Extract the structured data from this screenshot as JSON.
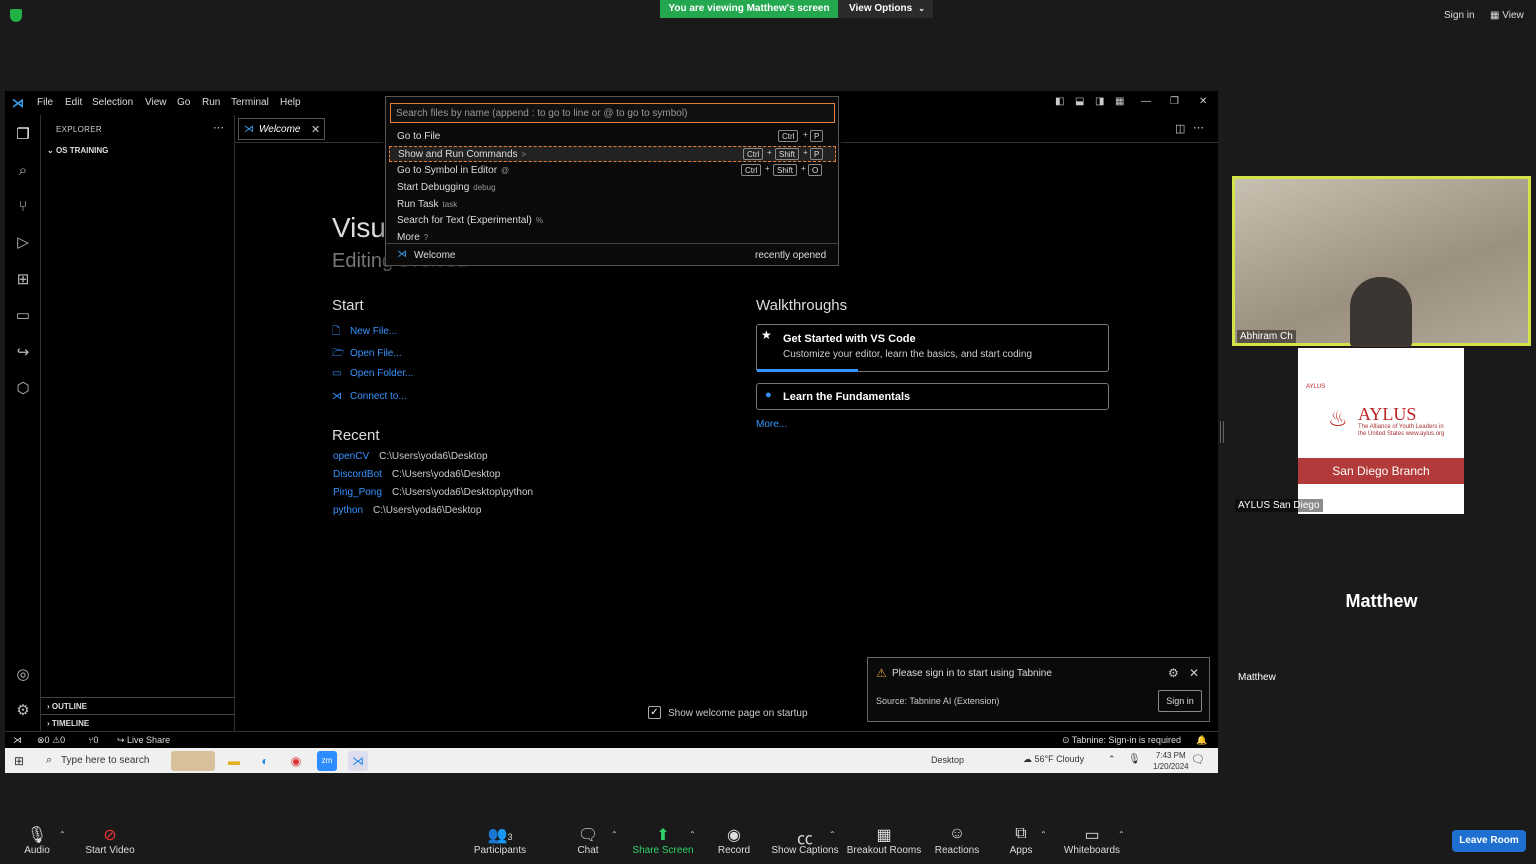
{
  "zoom": {
    "banner": "You are viewing Matthew's screen",
    "view_options": "View Options",
    "sign_in": "Sign in",
    "view": "View",
    "participants": [
      {
        "name": "Abhiram Ch"
      },
      {
        "name": "AYLUS San Diego"
      },
      {
        "name": "Matthew"
      }
    ],
    "aylus_logo": {
      "small": "AYLUS",
      "name": "AYLUS",
      "tagline": "The Alliance of Youth Leaders in the United States www.aylus.org",
      "branch": "San Diego Branch"
    },
    "toolbar": [
      {
        "label": "Audio",
        "icon": "microphone-icon"
      },
      {
        "label": "Start Video",
        "icon": "video-off-icon"
      },
      {
        "label": "Participants",
        "icon": "participants-icon",
        "count": "3"
      },
      {
        "label": "Chat",
        "icon": "chat-icon"
      },
      {
        "label": "Share Screen",
        "icon": "share-screen-icon"
      },
      {
        "label": "Record",
        "icon": "record-icon"
      },
      {
        "label": "Show Captions",
        "icon": "captions-icon"
      },
      {
        "label": "Breakout Rooms",
        "icon": "breakout-rooms-icon"
      },
      {
        "label": "Reactions",
        "icon": "reactions-icon"
      },
      {
        "label": "Apps",
        "icon": "apps-icon"
      },
      {
        "label": "Whiteboards",
        "icon": "whiteboard-icon"
      }
    ],
    "leave": "Leave Room",
    "colors": {
      "banner": "#23a850",
      "active_speaker": "#d4e34a",
      "leave": "#1e6fd0"
    }
  },
  "vscode": {
    "menu": [
      "File",
      "Edit",
      "Selection",
      "View",
      "Go",
      "Run",
      "Terminal",
      "Help"
    ],
    "explorer_title": "EXPLORER",
    "folder": "OS TRAINING",
    "outline": "OUTLINE",
    "timeline": "TIMELINE",
    "tab": "Welcome",
    "welcome": {
      "title": "Visu",
      "subtitle": "Editing evolved",
      "start_heading": "Start",
      "start_links": [
        "New File...",
        "Open File...",
        "Open Folder...",
        "Connect to..."
      ],
      "recent_heading": "Recent",
      "recent": [
        {
          "name": "openCV",
          "path": "C:\\Users\\yoda6\\Desktop"
        },
        {
          "name": "DiscordBot",
          "path": "C:\\Users\\yoda6\\Desktop"
        },
        {
          "name": "Ping_Pong",
          "path": "C:\\Users\\yoda6\\Desktop\\python"
        },
        {
          "name": "python",
          "path": "C:\\Users\\yoda6\\Desktop"
        }
      ],
      "walkthroughs_heading": "Walkthroughs",
      "card1_title": "Get Started with VS Code",
      "card1_desc": "Customize your editor, learn the basics, and start coding",
      "card2_title": "Learn the Fundamentals",
      "more": "More...",
      "show_on_startup": "Show welcome page on startup"
    },
    "quickpick": {
      "placeholder": "Search files by name (append : to go to line or @ to go to symbol)",
      "items": [
        {
          "label": "Go to File",
          "hint": "",
          "keys": [
            "Ctrl",
            "P"
          ]
        },
        {
          "label": "Show and Run Commands",
          "hint": ">",
          "keys": [
            "Ctrl",
            "Shift",
            "P"
          ]
        },
        {
          "label": "Go to Symbol in Editor",
          "hint": "@",
          "keys": [
            "Ctrl",
            "Shift",
            "O"
          ]
        },
        {
          "label": "Start Debugging",
          "hint": "debug",
          "keys": []
        },
        {
          "label": "Run Task",
          "hint": "task",
          "keys": []
        },
        {
          "label": "Search for Text (Experimental)",
          "hint": "%",
          "keys": []
        },
        {
          "label": "More",
          "hint": "?",
          "keys": []
        }
      ],
      "recent_item": "Welcome",
      "recent_label": "recently opened"
    },
    "notification": {
      "text": "Please sign in to start using Tabnine",
      "source": "Source: Tabnine AI (Extension)",
      "button": "Sign in"
    },
    "status": {
      "errors": "0",
      "warnings": "0",
      "ports": "0",
      "live_share": "Live Share",
      "tabnine": "Tabnine: Sign-in is required"
    },
    "colors": {
      "link": "#3794ff",
      "accent": "#3aa0f0",
      "focus": "#e0803a"
    }
  },
  "taskbar": {
    "search": "Type here to search",
    "desktop": "Desktop",
    "weather": "56°F",
    "condition": "Cloudy",
    "time": "7:43 PM",
    "date": "1/20/2024"
  }
}
